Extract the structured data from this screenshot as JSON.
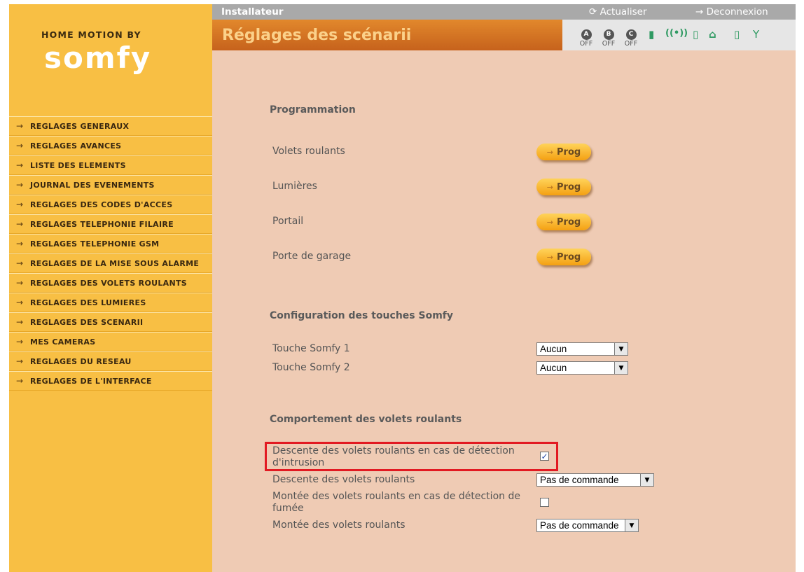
{
  "logo": {
    "top_text": "HOME MOTION BY",
    "brand": "somfy"
  },
  "sidebar": {
    "items": [
      {
        "label": "REGLAGES GENERAUX"
      },
      {
        "label": "REGLAGES AVANCES"
      },
      {
        "label": "LISTE DES ELEMENTS"
      },
      {
        "label": "JOURNAL DES EVENEMENTS"
      },
      {
        "label": "REGLAGES DES CODES D'ACCES"
      },
      {
        "label": "REGLAGES TELEPHONIE FILAIRE"
      },
      {
        "label": "REGLAGES TELEPHONIE GSM"
      },
      {
        "label": "REGLAGES DE LA MISE SOUS ALARME"
      },
      {
        "label": "REGLAGES DES VOLETS ROULANTS"
      },
      {
        "label": "REGLAGES DES LUMIERES"
      },
      {
        "label": "REGLAGES DES SCENARII"
      },
      {
        "label": "MES CAMERAS"
      },
      {
        "label": "REGLAGES DU RESEAU"
      },
      {
        "label": "REGLAGES DE L'INTERFACE"
      }
    ]
  },
  "header": {
    "user_label": "Installateur",
    "refresh_label": "Actualiser",
    "logout_label": "Deconnexion",
    "page_title": "Réglages des scénarii"
  },
  "status": {
    "zones": [
      {
        "letter": "A",
        "state": "OFF"
      },
      {
        "letter": "B",
        "state": "OFF"
      },
      {
        "letter": "C",
        "state": "OFF"
      }
    ],
    "icons": [
      "battery-icon",
      "signal-icon",
      "door-icon",
      "home-ok-icon",
      "door-open-icon",
      "antenna-icon"
    ],
    "icon_color": "#2f9a62"
  },
  "programmation": {
    "title": "Programmation",
    "button_label": "Prog",
    "rows": [
      {
        "label": "Volets roulants"
      },
      {
        "label": "Lumières"
      },
      {
        "label": "Portail"
      },
      {
        "label": "Porte de garage"
      }
    ]
  },
  "config": {
    "title": "Configuration des touches Somfy",
    "rows": [
      {
        "label": "Touche Somfy 1",
        "value": "Aucun"
      },
      {
        "label": "Touche Somfy 2",
        "value": "Aucun"
      }
    ]
  },
  "comportement": {
    "title": "Comportement des volets roulants",
    "intrusion_label": "Descente des volets roulants en cas de détection d'intrusion",
    "intrusion_checked": true,
    "descente_label": "Descente des volets roulants",
    "descente_value": "Pas de commande",
    "fumee_label": "Montée des volets roulants en cas de détection de fumée",
    "fumee_checked": false,
    "montee_label": "Montée des volets roulants",
    "montee_value": "Pas de commande"
  },
  "colors": {
    "sidebar": "#f8bf44",
    "title_bar": "#d0701f",
    "content_bg": "#efcbb4",
    "highlight": "#e21a22"
  }
}
